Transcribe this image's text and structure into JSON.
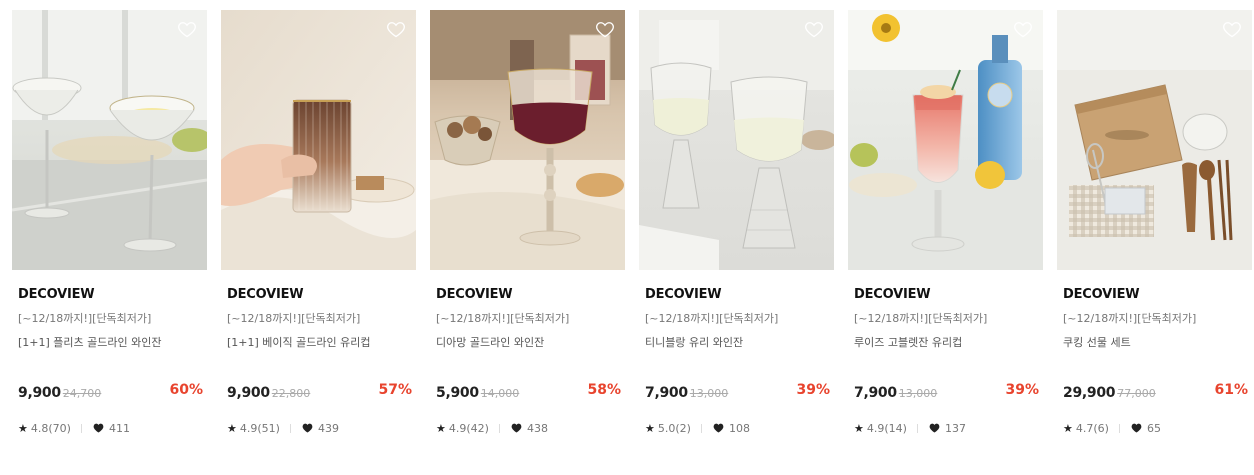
{
  "products": [
    {
      "brand": "DECOVIEW",
      "promo": "[~12/18까지!][단독최저가]",
      "name": "[1+1] 플리츠 골드라인 와인잔",
      "price": "9,900",
      "original_price": "24,700",
      "discount": "60%",
      "rating": "4.8(70)",
      "likes": "411",
      "scene": "coupe-glasses"
    },
    {
      "brand": "DECOVIEW",
      "promo": "[~12/18까지!][단독최저가]",
      "name": "[1+1] 베이직 골드라인 유리컵",
      "price": "9,900",
      "original_price": "22,800",
      "discount": "57%",
      "rating": "4.9(51)",
      "likes": "439",
      "scene": "hand-holding-ribbed-glass"
    },
    {
      "brand": "DECOVIEW",
      "promo": "[~12/18까지!][단독최저가]",
      "name": "디아망 골드라인 와인잔",
      "price": "5,900",
      "original_price": "14,000",
      "discount": "58%",
      "rating": "4.9(42)",
      "likes": "438",
      "scene": "red-wine-glass"
    },
    {
      "brand": "DECOVIEW",
      "promo": "[~12/18까지!][단독최저가]",
      "name": "티니블랑 유리 와인잔",
      "price": "7,900",
      "original_price": "13,000",
      "discount": "39%",
      "rating": "5.0(2)",
      "likes": "108",
      "scene": "white-wine-glasses"
    },
    {
      "brand": "DECOVIEW",
      "promo": "[~12/18까지!][단독최저가]",
      "name": "루이즈 고블렛잔 유리컵",
      "price": "7,900",
      "original_price": "13,000",
      "discount": "39%",
      "rating": "4.9(14)",
      "likes": "137",
      "scene": "pink-cocktail-goblet"
    },
    {
      "brand": "DECOVIEW",
      "promo": "[~12/18까지!][단독최저가]",
      "name": "쿠킹 선물 세트",
      "price": "29,900",
      "original_price": "77,000",
      "discount": "61%",
      "rating": "4.7(6)",
      "likes": "65",
      "scene": "cooking-gift-set"
    }
  ],
  "colors": {
    "discount": "#e8442e",
    "brand_text": "#111111",
    "muted_text": "#777777"
  }
}
